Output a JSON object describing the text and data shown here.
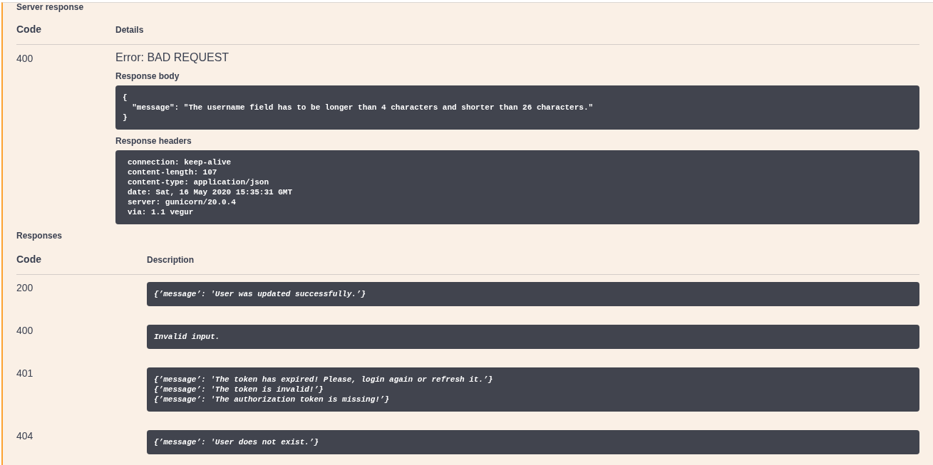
{
  "server_response": {
    "title": "Server response",
    "columns": [
      "Code",
      "Details"
    ],
    "code": "400",
    "error_title": "Error: BAD REQUEST",
    "response_body": {
      "label": "Response body",
      "lines": [
        "{",
        "  \"message\": \"The username field has to be longer than 4 characters and shorter than 26 characters.\"",
        "}"
      ]
    },
    "response_headers": {
      "label": "Response headers",
      "lines": [
        "connection: keep-alive",
        "content-length: 107",
        "content-type: application/json",
        "date: Sat, 16 May 2020 15:35:31 GMT",
        "server: gunicorn/20.0.4",
        "via: 1.1 vegur"
      ]
    }
  },
  "responses": {
    "title": "Responses",
    "columns": [
      "Code",
      "Description"
    ],
    "rows": [
      {
        "code": "200",
        "description": [
          "{’message’: 'User was updated successfully.’}"
        ]
      },
      {
        "code": "400",
        "description": [
          "Invalid input."
        ]
      },
      {
        "code": "401",
        "description": [
          "{’message’: 'The token has expired! Please, login again or refresh it.’}",
          "{’message’: 'The token is invalid!’}",
          "{’message’: 'The authorization token is missing!’}"
        ]
      },
      {
        "code": "404",
        "description": [
          "{’message’: 'User does not exist.’}"
        ]
      }
    ]
  }
}
